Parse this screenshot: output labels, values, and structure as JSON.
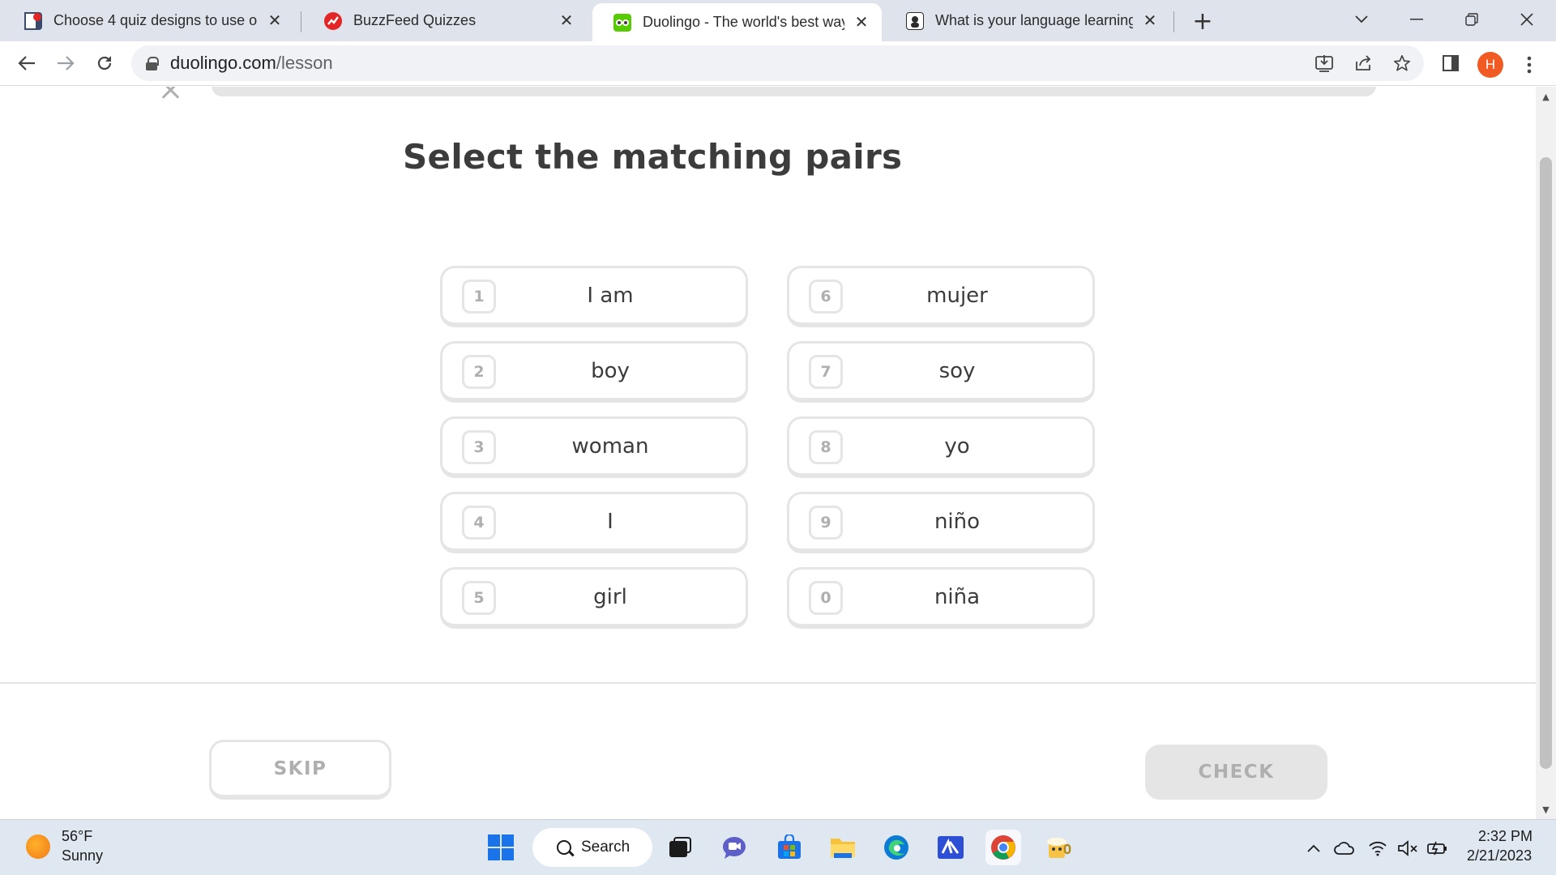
{
  "browser": {
    "tabs": [
      {
        "title": "Choose 4 quiz designs to use on",
        "favicon_color": "#3b4a6b",
        "active": false
      },
      {
        "title": "BuzzFeed Quizzes",
        "favicon_color": "#e32526",
        "active": false
      },
      {
        "title": "Duolingo - The world's best way",
        "favicon_color": "#58cc02",
        "active": true
      },
      {
        "title": "What is your language learning s",
        "favicon_color": "#2b2b2b",
        "active": false
      }
    ],
    "close_glyph": "✕",
    "new_tab_glyph": "+",
    "url_domain": "duolingo.com",
    "url_path": "/lesson",
    "profile_initial": "H",
    "profile_color": "#f15a22"
  },
  "lesson": {
    "heading": "Select the matching pairs",
    "left_options": [
      {
        "key": "1",
        "word": "I am"
      },
      {
        "key": "2",
        "word": "boy"
      },
      {
        "key": "3",
        "word": "woman"
      },
      {
        "key": "4",
        "word": "I"
      },
      {
        "key": "5",
        "word": "girl"
      }
    ],
    "right_options": [
      {
        "key": "6",
        "word": "mujer"
      },
      {
        "key": "7",
        "word": "soy"
      },
      {
        "key": "8",
        "word": "yo"
      },
      {
        "key": "9",
        "word": "niño"
      },
      {
        "key": "0",
        "word": "niña"
      }
    ],
    "skip_label": "SKIP",
    "check_label": "CHECK",
    "border_color": "#e5e5e5",
    "muted_text_color": "#afafaf"
  },
  "taskbar": {
    "weather_temp": "56°F",
    "weather_condition": "Sunny",
    "search_label": "Search",
    "time": "2:32 PM",
    "date": "2/21/2023"
  }
}
